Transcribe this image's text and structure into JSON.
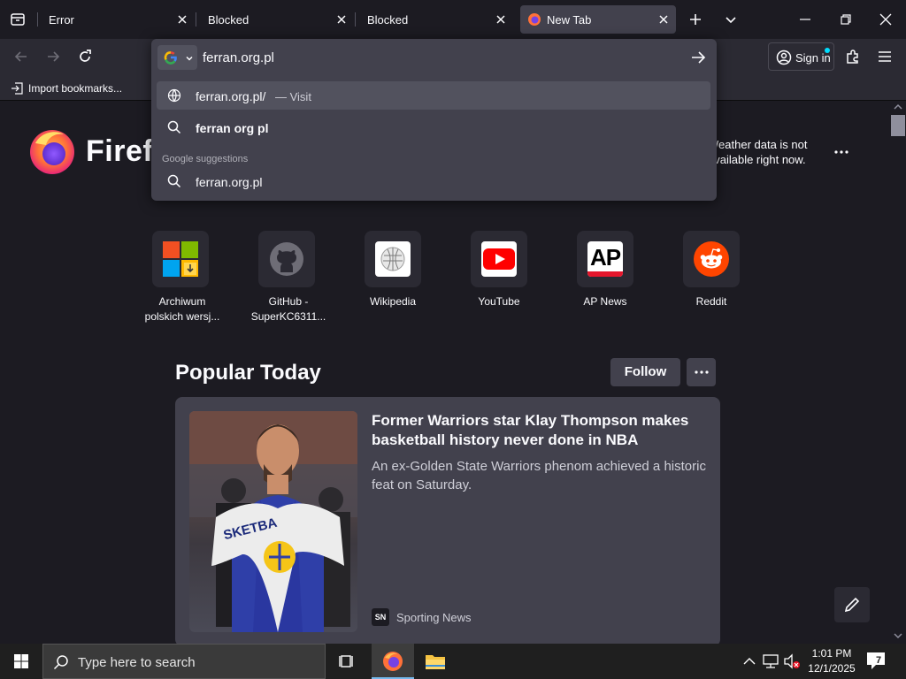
{
  "tabs": [
    {
      "label": "Error"
    },
    {
      "label": "Blocked"
    },
    {
      "label": "Blocked"
    },
    {
      "label": "New Tab"
    }
  ],
  "toolbar": {
    "sign_in_label": "Sign in"
  },
  "urlbar": {
    "value": "ferran.org.pl",
    "suggestions": [
      {
        "text": "ferran.org.pl/",
        "suffix": "— Visit"
      },
      {
        "text": "ferran org pl"
      }
    ],
    "google_header": "Google suggestions",
    "google_suggestions": [
      {
        "text": "ferran.org.pl"
      }
    ]
  },
  "bookmarks": {
    "import_label": "Import bookmarks..."
  },
  "brand": {
    "name": "Firefox"
  },
  "weather": {
    "line1": "Weather data is not",
    "line2": "available right now."
  },
  "shortcuts": [
    {
      "label_line1": "Archiwum",
      "label_line2": "polskich wersj..."
    },
    {
      "label_line1": "GitHub -",
      "label_line2": "SuperKC6311..."
    },
    {
      "label_line1": "Wikipedia",
      "label_line2": ""
    },
    {
      "label_line1": "YouTube",
      "label_line2": ""
    },
    {
      "label_line1": "AP News",
      "label_line2": ""
    },
    {
      "label_line1": "Reddit",
      "label_line2": ""
    }
  ],
  "shortcut_icons": {
    "ap_text": "AP"
  },
  "popular": {
    "title": "Popular Today",
    "follow_label": "Follow"
  },
  "article": {
    "headline": "Former Warriors star Klay Thompson makes basketball history never done in NBA",
    "excerpt": "An ex-Golden State Warriors phenom achieved a historic feat on Saturday.",
    "source_badge": "SN",
    "source": "Sporting News",
    "image_text": "SKETBA"
  },
  "taskbar": {
    "search_placeholder": "Type here to search",
    "time": "1:01 PM",
    "date": "12/1/2025",
    "notification_count": "7"
  }
}
